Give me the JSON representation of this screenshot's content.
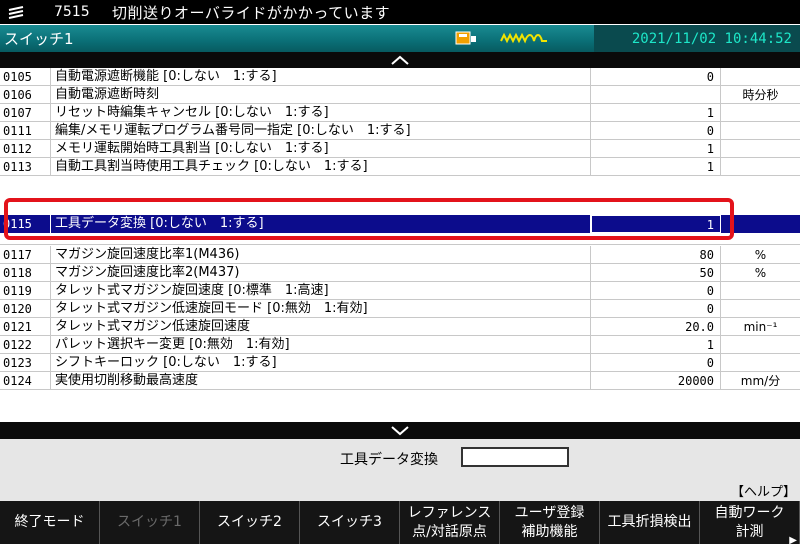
{
  "alarm": {
    "icon": "alarm-arrows-icon",
    "code": "7515",
    "message": "切削送りオーバライドがかかっています"
  },
  "header": {
    "title": "スイッチ1",
    "datetime": "2021/11/02 10:44:52",
    "icons": [
      "memory-card-icon",
      "spindle-wave-icon"
    ],
    "colors": {
      "bar": "#0a6f76",
      "datetime_bg": "#0a4a4e",
      "datetime_text": "#1de6c8",
      "wave": "#f2e400"
    }
  },
  "params": [
    {
      "num": "0105",
      "name": "自動電源遮断機能 [0:しない　1:する]",
      "value": "0",
      "unit": ""
    },
    {
      "num": "0106",
      "name": "自動電源遮断時刻",
      "value": "",
      "unit": "時分秒"
    },
    {
      "num": "0107",
      "name": "リセット時編集キャンセル [0:しない　1:する]",
      "value": "1",
      "unit": ""
    },
    {
      "num": "0111",
      "name": "編集/メモリ運転プログラム番号同一指定 [0:しない　1:する]",
      "value": "0",
      "unit": ""
    },
    {
      "num": "0112",
      "name": "メモリ運転開始時工具割当 [0:しない　1:する]",
      "value": "1",
      "unit": ""
    },
    {
      "num": "0113",
      "name": "自動工具割当時使用工具チェック [0:しない　1:する]",
      "value": "1",
      "unit": ""
    },
    {
      "num": "0117",
      "name": "マガジン旋回速度比率1(M436)",
      "value": "80",
      "unit": "%"
    },
    {
      "num": "0118",
      "name": "マガジン旋回速度比率2(M437)",
      "value": "50",
      "unit": "%"
    },
    {
      "num": "0119",
      "name": "タレット式マガジン旋回速度 [0:標準　1:高速]",
      "value": "0",
      "unit": ""
    },
    {
      "num": "0120",
      "name": "タレット式マガジン低速旋回モード [0:無効　1:有効]",
      "value": "0",
      "unit": ""
    },
    {
      "num": "0121",
      "name": "タレット式マガジン低速旋回速度",
      "value": "20.0",
      "unit": "min⁻¹"
    },
    {
      "num": "0122",
      "name": "パレット選択キー変更 [0:無効　1:有効]",
      "value": "1",
      "unit": ""
    },
    {
      "num": "0123",
      "name": "シフトキーロック [0:しない　1:する]",
      "value": "0",
      "unit": ""
    },
    {
      "num": "0124",
      "name": "実使用切削移動最高速度",
      "value": "20000",
      "unit": "mm/分"
    }
  ],
  "selected": {
    "num": "0115",
    "name": "工具データ変換 [0:しない　1:する]",
    "value": "1",
    "highlight_color": "#e3131b",
    "row_color": "#0c0c8c"
  },
  "input": {
    "label": "工具データ変換",
    "value": ""
  },
  "help": "【ヘルプ】",
  "softkeys": [
    {
      "line1": "終了モード",
      "line2": "",
      "enabled": true
    },
    {
      "line1": "スイッチ1",
      "line2": "",
      "enabled": false
    },
    {
      "line1": "スイッチ2",
      "line2": "",
      "enabled": true
    },
    {
      "line1": "スイッチ3",
      "line2": "",
      "enabled": true
    },
    {
      "line1": "レファレンス",
      "line2": "点/対話原点",
      "enabled": true
    },
    {
      "line1": "ユーザ登録",
      "line2": "補助機能",
      "enabled": true
    },
    {
      "line1": "工具折損検出",
      "line2": "",
      "enabled": true
    },
    {
      "line1": "自動ワーク",
      "line2": "計測",
      "enabled": true
    }
  ]
}
